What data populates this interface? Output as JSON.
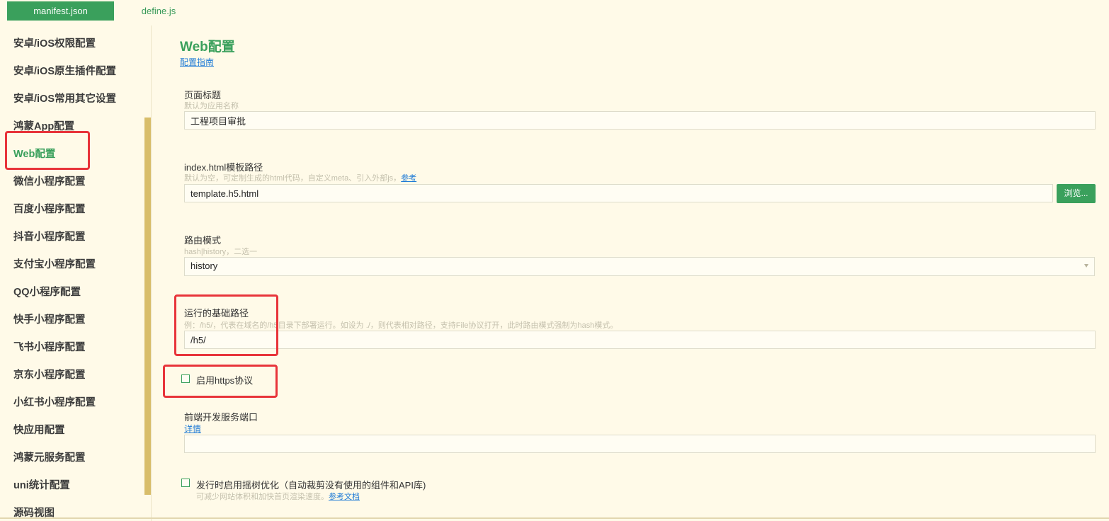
{
  "tabs": [
    {
      "label": "manifest.json",
      "active": true
    },
    {
      "label": "define.js",
      "active": false
    }
  ],
  "sidebar": {
    "items": [
      {
        "label": "安卓/iOS权限配置"
      },
      {
        "label": "安卓/iOS原生插件配置"
      },
      {
        "label": "安卓/iOS常用其它设置"
      },
      {
        "label": "鸿蒙App配置"
      },
      {
        "label": "Web配置",
        "active": true
      },
      {
        "label": "微信小程序配置"
      },
      {
        "label": "百度小程序配置"
      },
      {
        "label": "抖音小程序配置"
      },
      {
        "label": "支付宝小程序配置"
      },
      {
        "label": "QQ小程序配置"
      },
      {
        "label": "快手小程序配置"
      },
      {
        "label": "飞书小程序配置"
      },
      {
        "label": "京东小程序配置"
      },
      {
        "label": "小红书小程序配置"
      },
      {
        "label": "快应用配置"
      },
      {
        "label": "鸿蒙元服务配置"
      },
      {
        "label": "uni统计配置"
      },
      {
        "label": "源码视图"
      }
    ]
  },
  "main": {
    "title": "Web配置",
    "guide_link": "配置指南",
    "page_title_field": {
      "label": "页面标题",
      "hint": "默认为应用名称",
      "value": "工程项目审批"
    },
    "template_field": {
      "label": "index.html模板路径",
      "hint": "默认为空，可定制生成的html代码，自定义meta、引入外部js，",
      "hint_link": "参考",
      "value": "template.h5.html",
      "browse_button": "浏览..."
    },
    "router_mode": {
      "label": "路由模式",
      "hint": "hash|history，二选一",
      "value": "history"
    },
    "base_path": {
      "label": "运行的基础路径",
      "hint": "例：/h5/，代表在域名的/h5目录下部署运行。如设为 ./，则代表相对路径，支持File协议打开，此时路由模式强制为hash模式。",
      "value": "/h5/"
    },
    "https_checkbox": {
      "label": "启用https协议",
      "checked": false
    },
    "dev_port": {
      "label": "前端开发服务端口",
      "link": "详情",
      "value": ""
    },
    "tree_shaking": {
      "label": "发行时启用摇树优化（自动裁剪没有使用的组件和API库)",
      "hint": "可减少网站体积和加快首页渲染速度。",
      "hint_link": "参考文档",
      "checked": false
    }
  },
  "colors": {
    "accent": "#3aa05c",
    "background": "#fffae8",
    "highlight_box": "#e8343a",
    "link": "#1f7bd6",
    "scrollbar": "#d8bd6a"
  }
}
